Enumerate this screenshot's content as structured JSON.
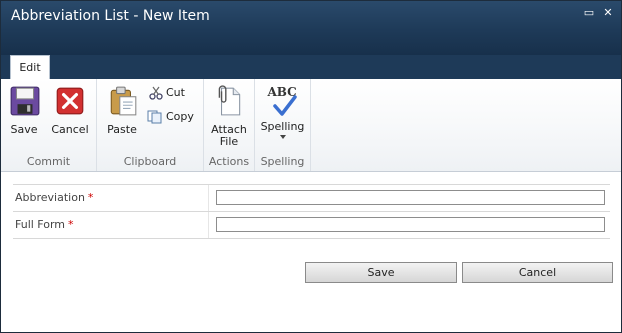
{
  "dialog": {
    "title": "Abbreviation List - New Item",
    "maximize_glyph": "▭",
    "close_glyph": "✕"
  },
  "ribbon": {
    "tabs": [
      {
        "label": "Edit"
      }
    ],
    "groups": {
      "commit": {
        "label": "Commit",
        "save": "Save",
        "cancel": "Cancel"
      },
      "clipboard": {
        "label": "Clipboard",
        "paste": "Paste",
        "cut": "Cut",
        "copy": "Copy"
      },
      "actions": {
        "label": "Actions",
        "attach_line1": "Attach",
        "attach_line2": "File"
      },
      "spelling": {
        "label": "Spelling",
        "spelling": "Spelling",
        "abc": "ABC"
      }
    }
  },
  "form": {
    "required_marker": "*",
    "fields": [
      {
        "label": "Abbreviation",
        "value": ""
      },
      {
        "label": "Full Form",
        "value": ""
      }
    ]
  },
  "buttons": {
    "save": "Save",
    "cancel": "Cancel"
  },
  "colors": {
    "title_bar": "#1e3a58",
    "required": "#cc0000",
    "save_icon": "#5a3a8a",
    "cancel_icon": "#c62a2a",
    "check": "#3a6fd0"
  },
  "icons": [
    "save-icon",
    "cancel-icon",
    "paste-icon",
    "cut-icon",
    "copy-icon",
    "attach-file-icon",
    "spelling-icon",
    "dropdown-arrow-icon",
    "maximize-icon",
    "close-icon"
  ]
}
